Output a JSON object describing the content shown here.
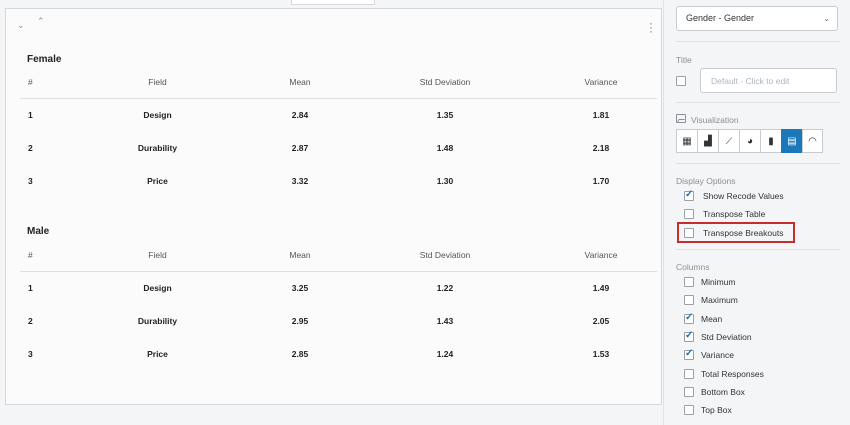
{
  "table_panel": {
    "groups": [
      {
        "title": "Female",
        "headers": [
          "#",
          "Field",
          "Mean",
          "Std Deviation",
          "Variance"
        ],
        "rows": [
          [
            "1",
            "Design",
            "2.84",
            "1.35",
            "1.81"
          ],
          [
            "2",
            "Durability",
            "2.87",
            "1.48",
            "2.18"
          ],
          [
            "3",
            "Price",
            "3.32",
            "1.30",
            "1.70"
          ]
        ]
      },
      {
        "title": "Male",
        "headers": [
          "#",
          "Field",
          "Mean",
          "Std Deviation",
          "Variance"
        ],
        "rows": [
          [
            "1",
            "Design",
            "3.25",
            "1.22",
            "1.49"
          ],
          [
            "2",
            "Durability",
            "2.95",
            "1.43",
            "2.05"
          ],
          [
            "3",
            "Price",
            "2.85",
            "1.24",
            "1.53"
          ]
        ]
      }
    ]
  },
  "sidebar": {
    "breakout_value": "Gender - Gender",
    "title_label": "Title",
    "title_placeholder": "Default - Click to edit",
    "visualization_label": "Visualization",
    "visualization_icons": [
      "table-icon",
      "bar-chart-icon",
      "line-chart-icon",
      "pie-chart-icon",
      "stacked-bar-icon",
      "data-table-icon",
      "gauge-icon"
    ],
    "visualization_selected": "data-table-icon",
    "display_options_label": "Display Options",
    "display_options": [
      {
        "label": "Show Recode Values",
        "checked": true
      },
      {
        "label": "Transpose Table",
        "checked": false
      },
      {
        "label": "Transpose Breakouts",
        "checked": false
      }
    ],
    "columns_label": "Columns",
    "columns": [
      {
        "label": "Minimum",
        "checked": false
      },
      {
        "label": "Maximum",
        "checked": false
      },
      {
        "label": "Mean",
        "checked": true
      },
      {
        "label": "Std Deviation",
        "checked": true
      },
      {
        "label": "Variance",
        "checked": true
      },
      {
        "label": "Total Responses",
        "checked": false
      },
      {
        "label": "Bottom Box",
        "checked": false
      },
      {
        "label": "Top Box",
        "checked": false
      }
    ],
    "highlight_color": "#c62d2d",
    "accent_color": "#1b78ba"
  }
}
